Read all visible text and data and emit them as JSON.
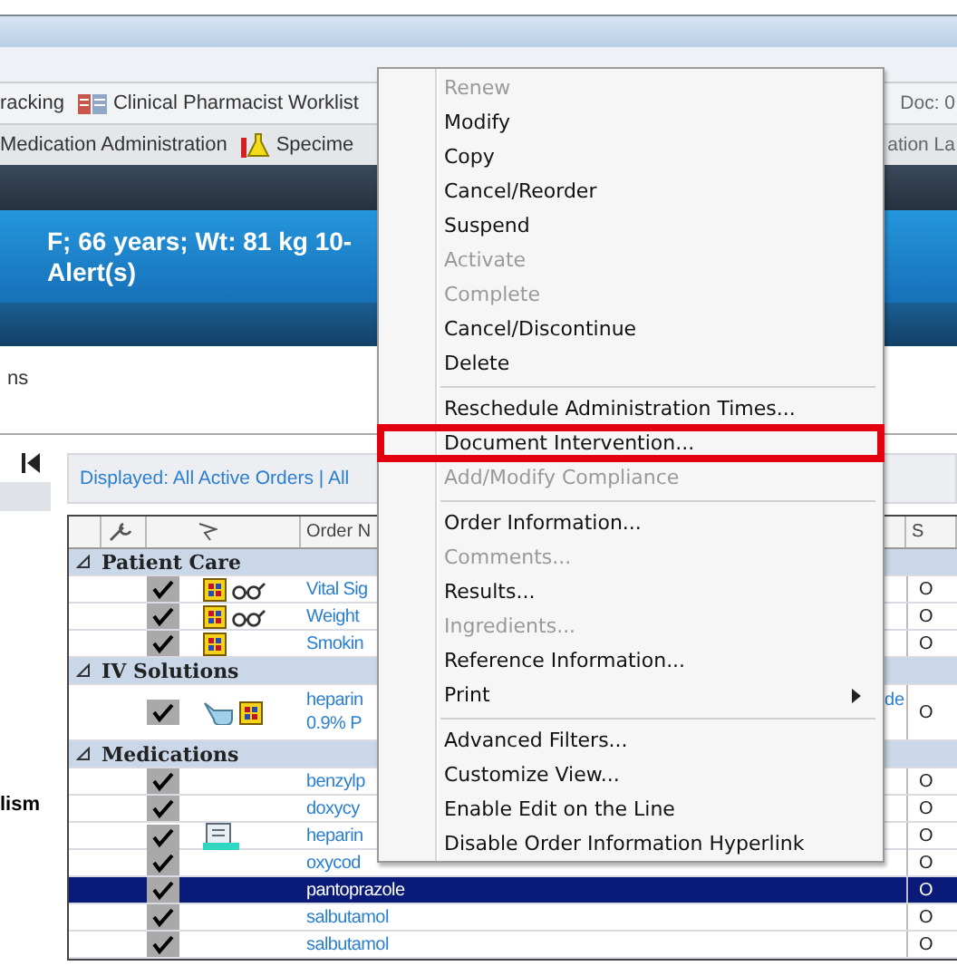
{
  "toolbar_1": {
    "items": [
      {
        "label": "racking",
        "kind": "plain"
      },
      {
        "label": "Clinical Pharmacist Worklist",
        "kind": "worklist"
      }
    ],
    "right": "Doc: 0"
  },
  "toolbar_2": {
    "items": [
      {
        "label": "Medication Administration",
        "kind": "plain"
      },
      {
        "label": "Specime",
        "kind": "flask"
      }
    ],
    "right": "ation La"
  },
  "banner": {
    "line_1": "F; 66 years; Wt: 81 kg 10-",
    "line_2": "Alert(s)"
  },
  "section_label": "ns",
  "sidebar": {
    "label": "lism"
  },
  "filter_bar": {
    "text": "Displayed: All Active Orders | All"
  },
  "table": {
    "columns": [
      {
        "kind": "wrench"
      },
      {
        "kind": "flag"
      },
      {
        "kind": "text",
        "label": "Order N"
      },
      {
        "kind": "text",
        "label": "S"
      }
    ],
    "rows": [
      {
        "kind": "group",
        "label": "Patient Care",
        "expanded": true
      },
      {
        "kind": "order",
        "checked": true,
        "icons": [
          {
            "kind": "note"
          },
          {
            "kind": "glasses"
          }
        ],
        "name": "Vital Sig",
        "selected": false,
        "status": "O"
      },
      {
        "kind": "order",
        "checked": true,
        "icons": [
          {
            "kind": "note"
          },
          {
            "kind": "glasses"
          }
        ],
        "name": "Weight",
        "selected": false,
        "status": "O"
      },
      {
        "kind": "order",
        "checked": true,
        "icons": [
          {
            "kind": "note"
          }
        ],
        "name": "Smokin",
        "selected": false,
        "status": "O"
      },
      {
        "kind": "group",
        "label": "IV Solutions",
        "expanded": true
      },
      {
        "kind": "order",
        "checked": true,
        "icons": [
          {
            "kind": "iv"
          },
          {
            "kind": "note"
          }
        ],
        "name": "heparin",
        "name_2": "0.9% P",
        "extra": "de",
        "selected": false,
        "status": "O"
      },
      {
        "kind": "group",
        "label": "Medications",
        "expanded": true
      },
      {
        "kind": "order",
        "checked": true,
        "name": "benzylp",
        "selected": false,
        "status": "O"
      },
      {
        "kind": "order",
        "checked": true,
        "name": "doxycy",
        "selected": false,
        "status": "O"
      },
      {
        "kind": "order",
        "checked": true,
        "icons": [
          {
            "kind": "pharmacy"
          }
        ],
        "name": "heparin",
        "selected": false,
        "status": "O"
      },
      {
        "kind": "order",
        "checked": true,
        "name": "oxycod",
        "selected": false,
        "status": "O"
      },
      {
        "kind": "order",
        "checked": true,
        "name": "pantoprazole",
        "selected": true,
        "status": "O"
      },
      {
        "kind": "order",
        "checked": true,
        "name": "salbutamol",
        "selected": false,
        "status": "O"
      },
      {
        "kind": "order",
        "checked": true,
        "name": "salbutamol",
        "selected": false,
        "status": "O"
      }
    ]
  },
  "context_menu": {
    "groups": [
      [
        {
          "label": "Renew",
          "disabled": true,
          "highlighted": false,
          "submenu": false
        },
        {
          "label": "Modify",
          "disabled": false,
          "highlighted": false,
          "submenu": false
        },
        {
          "label": "Copy",
          "disabled": false,
          "highlighted": false,
          "submenu": false
        },
        {
          "label": "Cancel/Reorder",
          "disabled": false,
          "highlighted": false,
          "submenu": false
        },
        {
          "label": "Suspend",
          "disabled": false,
          "highlighted": false,
          "submenu": false
        },
        {
          "label": "Activate",
          "disabled": true,
          "highlighted": false,
          "submenu": false
        },
        {
          "label": "Complete",
          "disabled": true,
          "highlighted": false,
          "submenu": false
        },
        {
          "label": "Cancel/Discontinue",
          "disabled": false,
          "highlighted": false,
          "submenu": false
        },
        {
          "label": "Delete",
          "disabled": false,
          "highlighted": false,
          "submenu": false
        }
      ],
      [
        {
          "label": "Reschedule Administration Times...",
          "disabled": false,
          "highlighted": false,
          "submenu": false
        },
        {
          "label": "Document Intervention...",
          "disabled": false,
          "highlighted": true,
          "submenu": false
        },
        {
          "label": "Add/Modify Compliance",
          "disabled": true,
          "highlighted": false,
          "submenu": false
        }
      ],
      [
        {
          "label": "Order Information...",
          "disabled": false,
          "highlighted": false,
          "submenu": false
        },
        {
          "label": "Comments...",
          "disabled": true,
          "highlighted": false,
          "submenu": false
        },
        {
          "label": "Results...",
          "disabled": false,
          "highlighted": false,
          "submenu": false
        },
        {
          "label": "Ingredients...",
          "disabled": true,
          "highlighted": false,
          "submenu": false
        },
        {
          "label": "Reference Information...",
          "disabled": false,
          "highlighted": false,
          "submenu": false
        },
        {
          "label": "Print",
          "disabled": false,
          "highlighted": false,
          "submenu": true
        }
      ],
      [
        {
          "label": "Advanced Filters...",
          "disabled": false,
          "highlighted": false,
          "submenu": false
        },
        {
          "label": "Customize View...",
          "disabled": false,
          "highlighted": false,
          "submenu": false
        },
        {
          "label": "Enable Edit on the Line",
          "disabled": false,
          "highlighted": false,
          "submenu": false
        },
        {
          "label": "Disable Order Information Hyperlink",
          "disabled": false,
          "highlighted": false,
          "submenu": false
        }
      ]
    ]
  }
}
